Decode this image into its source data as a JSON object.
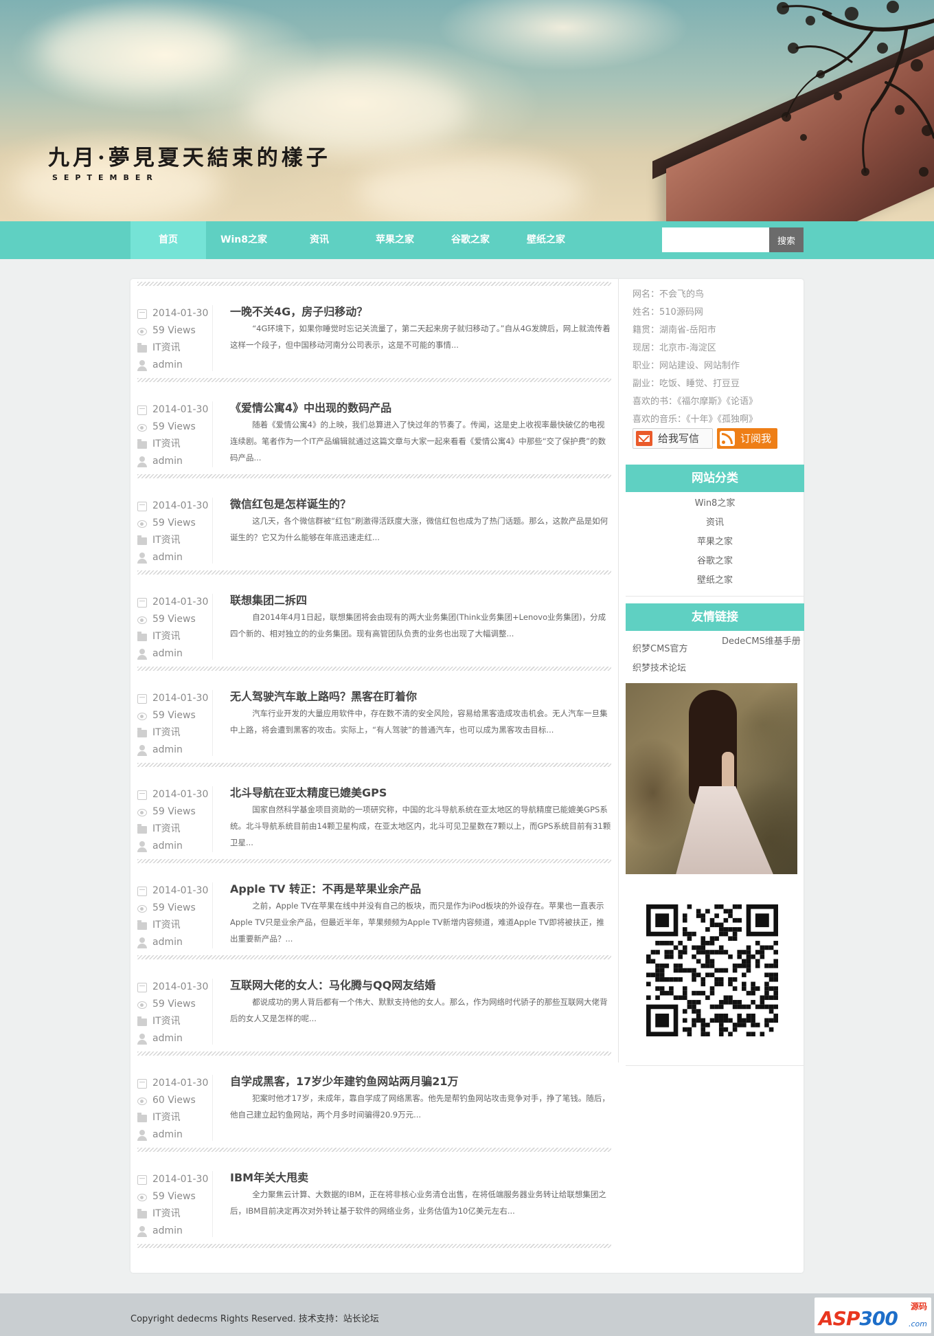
{
  "header": {
    "title": "九月·夢見夏天結束的樣子",
    "subtitle": "SEPTEMBER"
  },
  "nav": {
    "items": [
      "首页",
      "Win8之家",
      "资讯",
      "苹果之家",
      "谷歌之家",
      "壁纸之家"
    ],
    "active": "首页",
    "search_placeholder": "",
    "search_button": "搜索"
  },
  "posts": [
    {
      "date": "2014-01-30",
      "views": "59 Views",
      "category": "IT资讯",
      "author": "admin",
      "title": "一晚不关4G，房子归移动？",
      "summary": "“4G环境下，如果你睡觉时忘记关流量了，第二天起来房子就归移动了。”自从4G发牌后，网上就流传着这样一个段子，但中国移动河南分公司表示，这是不可能的事情..."
    },
    {
      "date": "2014-01-30",
      "views": "59 Views",
      "category": "IT资讯",
      "author": "admin",
      "title": "《爱情公寓4》中出现的数码产品",
      "summary": "随着《爱情公寓4》的上映，我们总算进入了快过年的节奏了。传闻，这是史上收视率最快破亿的电视连续剧。笔者作为一个IT产品编辑就通过这篇文章与大家一起来看看《爱情公寓4》中那些“交了保护费”的数码产品..."
    },
    {
      "date": "2014-01-30",
      "views": "59 Views",
      "category": "IT资讯",
      "author": "admin",
      "title": "微信红包是怎样诞生的？",
      "summary": "这几天，各个微信群被“红包”刷激得活跃度大涨，微信红包也成为了热门话题。那么，这款产品是如何诞生的？它又为什么能够在年底迅速走红..."
    },
    {
      "date": "2014-01-30",
      "views": "59 Views",
      "category": "IT资讯",
      "author": "admin",
      "title": "联想集团二拆四",
      "summary": "自2014年4月1日起，联想集团将会由现有的两大业务集团(Think业务集团+Lenovo业务集团)，分成四个新的、相对独立的的业务集团。现有高管团队负责的业务也出现了大幅调整..."
    },
    {
      "date": "2014-01-30",
      "views": "59 Views",
      "category": "IT资讯",
      "author": "admin",
      "title": "无人驾驶汽车敢上路吗？黑客在盯着你",
      "summary": "汽车行业开发的大量应用软件中，存在数不清的安全风险，容易给黑客造成攻击机会。无人汽车一旦集中上路，将会遭到黑客的攻击。实际上，“有人驾驶”的普通汽车，也可以成为黑客攻击目标..."
    },
    {
      "date": "2014-01-30",
      "views": "59 Views",
      "category": "IT资讯",
      "author": "admin",
      "title": "北斗导航在亚太精度已媲美GPS",
      "summary": "国家自然科学基金项目资助的一项研究称，中国的北斗导航系统在亚太地区的导航精度已能媲美GPS系统。北斗导航系统目前由14颗卫星构成，在亚太地区内，北斗可见卫星数在7颗以上，而GPS系统目前有31颗卫星..."
    },
    {
      "date": "2014-01-30",
      "views": "59 Views",
      "category": "IT资讯",
      "author": "admin",
      "title": "Apple TV 转正：不再是苹果业余产品",
      "summary": "之前，Apple TV在苹果在线中并没有自己的板块，而只是作为iPod板块的外设存在。苹果也一直表示Apple TV只是业余产品，但最近半年，苹果频频为Apple TV新增内容频道，难道Apple TV即将被扶正，推出重要新产品？..."
    },
    {
      "date": "2014-01-30",
      "views": "59 Views",
      "category": "IT资讯",
      "author": "admin",
      "title": "互联网大佬的女人：马化腾与QQ网友结婚",
      "summary": "都说成功的男人背后都有一个伟大、默默支持他的女人。那么，作为网络时代骄子的那些互联网大佬背后的女人又是怎样的呢..."
    },
    {
      "date": "2014-01-30",
      "views": "60 Views",
      "category": "IT资讯",
      "author": "admin",
      "title": "自学成黑客，17岁少年建钓鱼网站两月骗21万",
      "summary": "犯案时他才17岁，未成年，靠自学成了网络黑客。他先是帮钓鱼网站攻击竞争对手，挣了笔钱。随后，他自己建立起钓鱼网站，两个月多时间骗得20.9万元..."
    },
    {
      "date": "2014-01-30",
      "views": "59 Views",
      "category": "IT资讯",
      "author": "admin",
      "title": "IBM年关大甩卖",
      "summary": "全力聚焦云计算、大数据的IBM，正在将非核心业务清仓出售，在将低端服务器业务转让给联想集团之后，IBM目前决定再次对外转让基于软件的网络业务，业务估值为10亿美元左右..."
    }
  ],
  "sidebar": {
    "profile": [
      "网名：不会飞的鸟",
      "姓名：510源码网",
      "籍贯：湖南省-岳阳市",
      "现居：北京市-海淀区",
      "职业：网站建设、网站制作",
      "副业：吃饭、睡觉、打豆豆",
      "喜欢的书：《福尔摩斯》《论语》",
      "喜欢的音乐：《十年》《孤独啊》"
    ],
    "write_button": "给我写信",
    "subscribe_button": "订阅我",
    "categories_title": "网站分类",
    "categories": [
      "Win8之家",
      "资讯",
      "苹果之家",
      "谷歌之家",
      "壁纸之家"
    ],
    "links_title": "友情链接",
    "links": [
      "织梦CMS官方",
      "DedeCMS维基手册",
      "织梦技术论坛"
    ]
  },
  "footer": {
    "copyright": "Copyright dedecms Rights Reserved. 技术支持：站长论坛",
    "logo_asp": "ASP",
    "logo_300": "300",
    "logo_cn": "源码",
    "logo_com": ".com"
  }
}
